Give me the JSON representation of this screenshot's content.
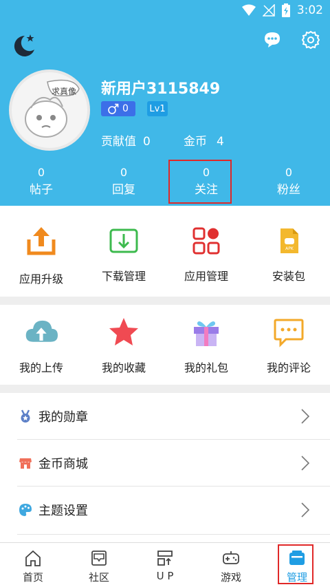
{
  "status_bar": {
    "time": "3:02"
  },
  "profile": {
    "avatar_label": "求真像",
    "username": "新用户3115849",
    "gender_count": "0",
    "level": "Lv1",
    "contribution_label": "贡献值",
    "contribution_value": "0",
    "coins_label": "金币",
    "coins_value": "4"
  },
  "counts": [
    {
      "value": "0",
      "label": "帖子"
    },
    {
      "value": "0",
      "label": "回复"
    },
    {
      "value": "0",
      "label": "关注"
    },
    {
      "value": "0",
      "label": "粉丝"
    }
  ],
  "grid1": [
    {
      "label": "应用升级",
      "icon": "upload-tray-icon"
    },
    {
      "label": "下载管理",
      "icon": "download-tray-icon"
    },
    {
      "label": "应用管理",
      "icon": "app-grid-icon"
    },
    {
      "label": "安装包",
      "icon": "apk-file-icon"
    }
  ],
  "grid2": [
    {
      "label": "我的上传",
      "icon": "cloud-upload-icon"
    },
    {
      "label": "我的收藏",
      "icon": "star-icon"
    },
    {
      "label": "我的礼包",
      "icon": "gift-icon"
    },
    {
      "label": "我的评论",
      "icon": "comment-icon"
    }
  ],
  "list": [
    {
      "label": "我的勋章",
      "icon": "medal-icon"
    },
    {
      "label": "金币商城",
      "icon": "shop-icon"
    },
    {
      "label": "主题设置",
      "icon": "palette-icon"
    }
  ],
  "nav": [
    {
      "label": "首页",
      "icon": "home-icon"
    },
    {
      "label": "社区",
      "icon": "community-icon"
    },
    {
      "label": "U P",
      "icon": "up-icon"
    },
    {
      "label": "游戏",
      "icon": "gamepad-icon"
    },
    {
      "label": "管理",
      "icon": "manage-icon"
    }
  ],
  "colors": {
    "header_bg": "#40B8E8",
    "highlight_box": "#E02828",
    "active_nav": "#1F9DE3"
  }
}
